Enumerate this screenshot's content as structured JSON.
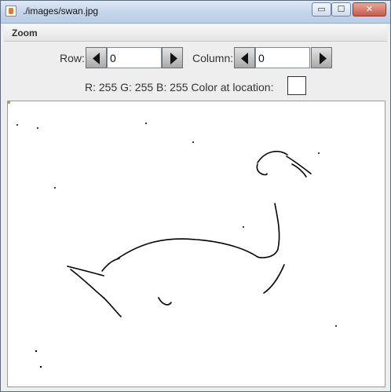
{
  "window": {
    "title": "./images/swan.jpg",
    "minimize_symbol": "▭",
    "maximize_symbol": "☐",
    "close_symbol": "✕"
  },
  "menu": {
    "zoom_label": "Zoom"
  },
  "controls": {
    "row_label": "Row:",
    "row_value": "0",
    "column_label": "Column:",
    "column_value": "0",
    "pixel_info": "R: 255 G: 255 B: 255 Color at location:",
    "swatch_color": "#ffffff"
  },
  "image": {
    "icon_prev": "left-arrow-icon",
    "icon_next": "right-arrow-icon",
    "description": "swan-edge-detection"
  }
}
